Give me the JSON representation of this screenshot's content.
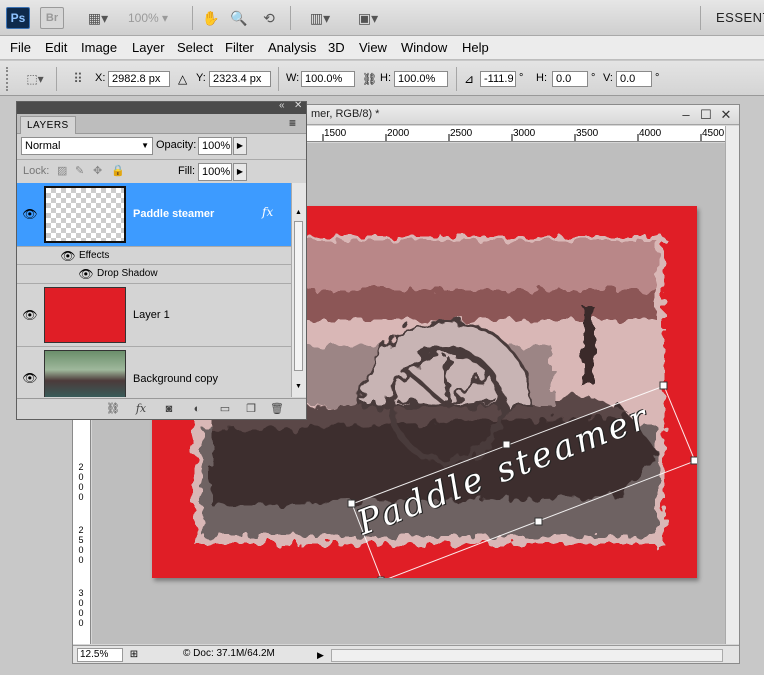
{
  "app": {
    "logo": "Ps",
    "bridge_logo": "Br",
    "zoom": "100%",
    "workspace": "ESSENTI"
  },
  "menu": [
    "File",
    "Edit",
    "Image",
    "Layer",
    "Select",
    "Filter",
    "Analysis",
    "3D",
    "View",
    "Window",
    "Help"
  ],
  "options": {
    "x_label": "X:",
    "x_value": "2982.8 px",
    "y_label": "Y:",
    "y_value": "2323.4 px",
    "w_label": "W:",
    "w_value": "100.0%",
    "h_label": "H:",
    "h_value": "100.0%",
    "angle_value": "-111.9",
    "angle_unit": "°",
    "hskew_label": "H:",
    "hskew_value": "0.0",
    "hskew_unit": "°",
    "vskew_label": "V:",
    "vskew_value": "0.0",
    "vskew_unit": "°"
  },
  "document": {
    "title": "mer, RGB/8) *",
    "ruler_h": [
      "1500",
      "2000",
      "2500",
      "3000",
      "3500",
      "4000",
      "4500"
    ],
    "ruler_v": [
      [
        "2",
        "0",
        "0",
        "0"
      ],
      [
        "2",
        "5",
        "0",
        "0"
      ],
      [
        "3",
        "0",
        "0",
        "0"
      ]
    ],
    "text_on_image": "Paddle steamer",
    "status_zoom": "12.5%",
    "status_doc": "Doc: 37.1M/64.2M"
  },
  "layers_panel": {
    "tab": "LAYERS",
    "blend_mode": "Normal",
    "opacity_label": "Opacity:",
    "opacity_value": "100%",
    "lock_label": "Lock:",
    "fill_label": "Fill:",
    "fill_value": "100%",
    "layers": [
      {
        "name": "Paddle steamer",
        "selected": true,
        "fx": "fx"
      },
      {
        "name": "Layer 1",
        "selected": false
      },
      {
        "name": "Background copy",
        "selected": false
      }
    ],
    "effects_label": "Effects",
    "drop_shadow_label": "Drop Shadow",
    "layer1_color": "#e01e26",
    "selected_color": "#3d9bff"
  }
}
